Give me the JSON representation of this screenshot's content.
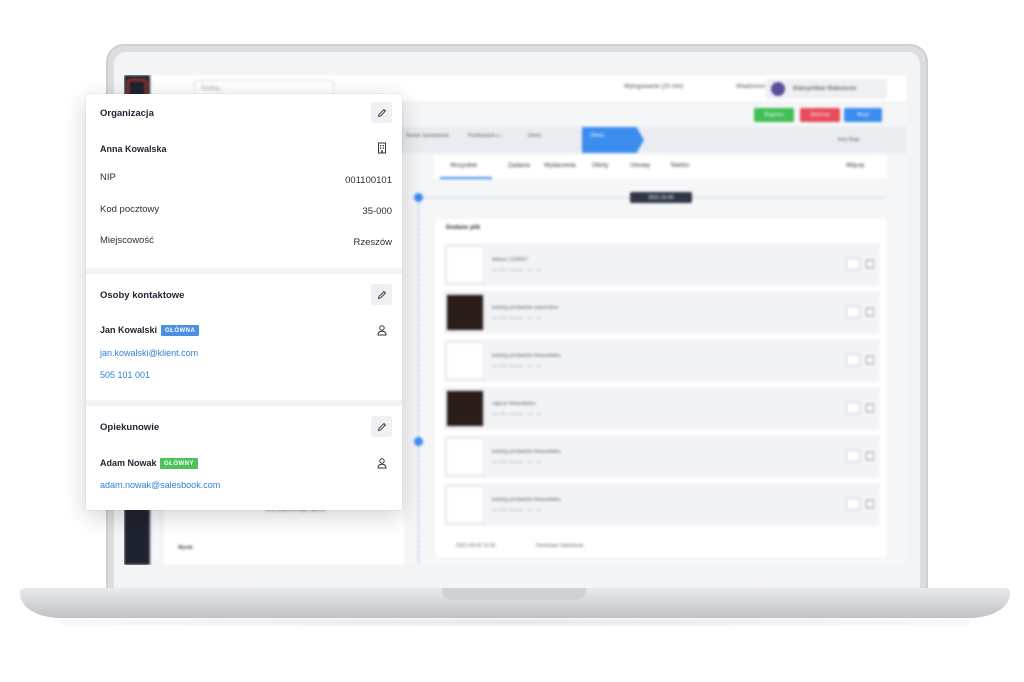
{
  "background_app": {
    "search_placeholder": "Szukaj...",
    "top_items": [
      "Wylogowanie (15 min)",
      "Wiadomości"
    ],
    "user_name": "Maksymilian Białostocki",
    "actions": [
      {
        "label": "Wygrany",
        "color": "#3fbf54"
      },
      {
        "label": "Stracony",
        "color": "#e84a5a"
      },
      {
        "label": "Akcje",
        "color": "#3b8df0"
      }
    ],
    "stages": [
      "Numer zamówienia",
      "Przekazanie z...",
      "Demo",
      "Oferta"
    ],
    "stage_extra": "Inny Etap",
    "tabs": [
      "Wszystkie",
      "Zadania",
      "Wydarzenia",
      "Oferty",
      "Umowy",
      "Telefon"
    ],
    "tab_right": "Więcej",
    "date_chip": "2021-10-05",
    "card_title": "Dodano plik",
    "files": [
      {
        "name": "faktura 1234567",
        "meta": "typ: PDF, rozmiar: ~ kb ~ px",
        "thumb": "light"
      },
      {
        "name": "katalog produktów automotive",
        "meta": "typ: PDF, rozmiar: ~ kb ~ px",
        "thumb": "dark"
      },
      {
        "name": "katalog produktów fotowoltaika",
        "meta": "typ: PDF, rozmiar: ~ kb ~ px",
        "thumb": "light"
      },
      {
        "name": "zdjęcie fotowoltaika",
        "meta": "typ: JPG, rozmiar: ~ kb ~ px",
        "thumb": "dark"
      },
      {
        "name": "katalog produktów fotowoltaika",
        "meta": "typ: PDF, rozmiar: ~ kb ~ px",
        "thumb": "light"
      },
      {
        "name": "katalog produktów fotowoltaika",
        "meta": "typ: PDF, rozmiar: ~ kb ~ px",
        "thumb": "light"
      }
    ],
    "card_footer_date": "2021-09-02 12:30",
    "card_footer_user": "Developer Salesbook",
    "left_bottom": "Wynik",
    "left_note": "Brak poprzedniego raportu"
  },
  "organization": {
    "title": "Organizacja",
    "name": "Anna Kowalska",
    "rows": [
      {
        "label": "NIP",
        "value": "001100101"
      },
      {
        "label": "Kod pocztowy",
        "value": "35-000"
      },
      {
        "label": "Miejscowość",
        "value": "Rzeszów"
      }
    ]
  },
  "contacts": {
    "title": "Osoby kontaktowe",
    "name": "Jan Kowalski",
    "badge": "GŁÓWNA",
    "email": "jan.kowalski@klient.com",
    "phone": "505 101 001"
  },
  "guardians": {
    "title": "Opiekunowie",
    "name": "Adam Nowak",
    "badge": "GŁÓWNY",
    "email": "adam.nowak@salesbook.com"
  }
}
